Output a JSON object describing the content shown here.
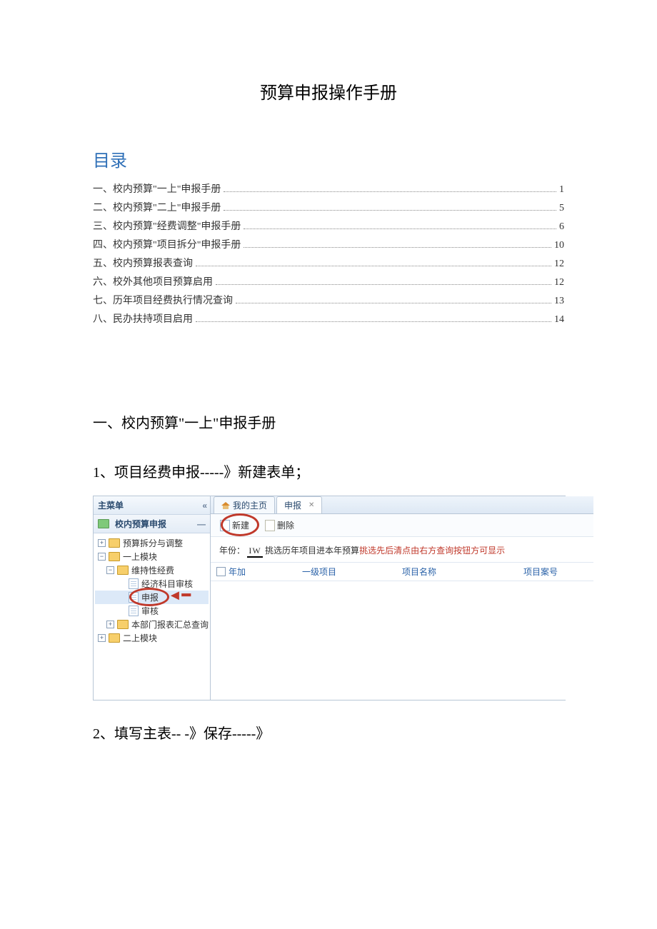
{
  "doc": {
    "title": "预算申报操作手册",
    "toc_heading": "目录",
    "toc": [
      {
        "label": "一、校内预算\"一上\"申报手册",
        "page": "1"
      },
      {
        "label": "二、校内预算\"二上\"申报手册",
        "page": "5"
      },
      {
        "label": "三、校内预算\"经费调整\"申报手册",
        "page": "6"
      },
      {
        "label": "四、校内预算\"项目拆分\"申报手册",
        "page": "10"
      },
      {
        "label": "五、校内预算报表查询",
        "page": "12"
      },
      {
        "label": "六、校外其他项目预算启用",
        "page": "12"
      },
      {
        "label": "七、历年项目经费执行情况查询",
        "page": "13"
      },
      {
        "label": "八、民办扶持项目启用",
        "page": "14"
      }
    ],
    "section1_heading": "一、校内预算\"一上\"申报手册",
    "step1_heading": "1、项目经费申报-----》新建表单；",
    "step2_heading": "2、填写主表--   -》保存-----》"
  },
  "app": {
    "sidebar_title": "主菜单",
    "sidebar_section": "校内预算申报",
    "tree": {
      "n1": "预算拆分与调整",
      "n2": "一上模块",
      "n3": "维持性经费",
      "n4": "经济科目审核",
      "n5": "申报",
      "n6": "审核",
      "n7": "本部门报表汇总查询",
      "n8": "二上模块"
    },
    "tabs": {
      "home": "我的主页",
      "declare": "申报"
    },
    "toolbar": {
      "new_label": "新建",
      "delete_label": "删除"
    },
    "filter": {
      "year_label": "年份：",
      "year_value": "IW",
      "desc_black": " 挑选历年项目进本年预算",
      "desc_red": "挑选先后清点由右方查询按钮方可显示"
    },
    "grid": {
      "c1": "年加",
      "c2": "一级项目",
      "c3": "项目名称",
      "c4": "项目案号"
    }
  }
}
